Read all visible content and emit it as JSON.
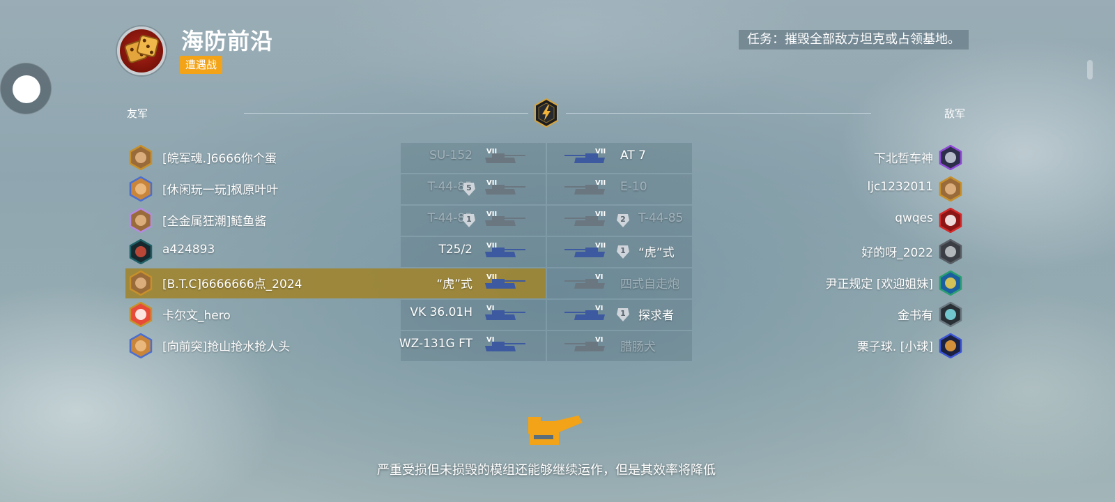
{
  "header": {
    "map_name": "海防前沿",
    "mode_badge": "遭遇战",
    "mission": "任务：摧毁全部敌方坦克或占领基地。"
  },
  "teams": {
    "allies_label": "友军",
    "enemies_label": "敌军"
  },
  "allies": [
    {
      "player": "[皖军魂.]6666你个蛋",
      "tank": "SU-152",
      "tier": "VII",
      "alive": false,
      "platoon": null,
      "avatar": "crate"
    },
    {
      "player": "[休闲玩一玩]枫原叶叶",
      "tank": "T-44-85",
      "tier": "VII",
      "alive": false,
      "platoon": "5",
      "avatar": "bear"
    },
    {
      "player": "[全金属狂潮]鲢鱼酱",
      "tank": "T-44-85",
      "tier": "VII",
      "alive": false,
      "platoon": "1",
      "avatar": "crate-purple"
    },
    {
      "player": "a424893",
      "tank": "T25/2",
      "tier": "VII",
      "alive": true,
      "platoon": null,
      "avatar": "dark-hex"
    },
    {
      "player": "[B.T.C]6666666点_2024",
      "tank": "“虎”式",
      "tier": "VII",
      "alive": true,
      "platoon": null,
      "avatar": "crate",
      "highlight": true
    },
    {
      "player": "卡尔文_hero",
      "tank": "VK 36.01H",
      "tier": "VI",
      "alive": true,
      "platoon": null,
      "avatar": "snowman"
    },
    {
      "player": "[向前突]抢山抢水抢人头",
      "tank": "WZ-131G FT",
      "tier": "VI",
      "alive": true,
      "platoon": null,
      "avatar": "bear"
    }
  ],
  "enemies": [
    {
      "player": "下北哲车神",
      "tank": "AT 7",
      "tier": "VII",
      "alive": true,
      "platoon": null,
      "avatar": "purple-a"
    },
    {
      "player": "ljc1232011",
      "tank": "E-10",
      "tier": "VII",
      "alive": false,
      "platoon": null,
      "avatar": "crate"
    },
    {
      "player": "qwqes",
      "tank": "T-44-85",
      "tier": "VII",
      "alive": false,
      "platoon": "2",
      "avatar": "red-helmet"
    },
    {
      "player": "好的呀_2022",
      "tank": "“虎”式",
      "tier": "VII",
      "alive": true,
      "platoon": "1",
      "avatar": "grey-person"
    },
    {
      "player": "尹正规定 [欢迎姐妹]",
      "tank": "四式自走炮",
      "tier": "VI",
      "alive": false,
      "platoon": null,
      "avatar": "five-badge"
    },
    {
      "player": "金书有",
      "tank": "探求者",
      "tier": "VI",
      "alive": true,
      "platoon": "1",
      "avatar": "dark-circle"
    },
    {
      "player": "栗子球. [小球]",
      "tank": "腊肠犬",
      "tier": "VI",
      "alive": false,
      "platoon": null,
      "avatar": "blue-rocket"
    }
  ],
  "hint": "严重受损但未损毁的模组还能够继续运作，但是其效率将降低",
  "colors": {
    "badge": "#f2a318",
    "highlight_row": "#a0822a",
    "tank_alive_ally": "#3d5aa0",
    "tank_dead": "#6b7780",
    "hint_icon": "#f2a318"
  }
}
